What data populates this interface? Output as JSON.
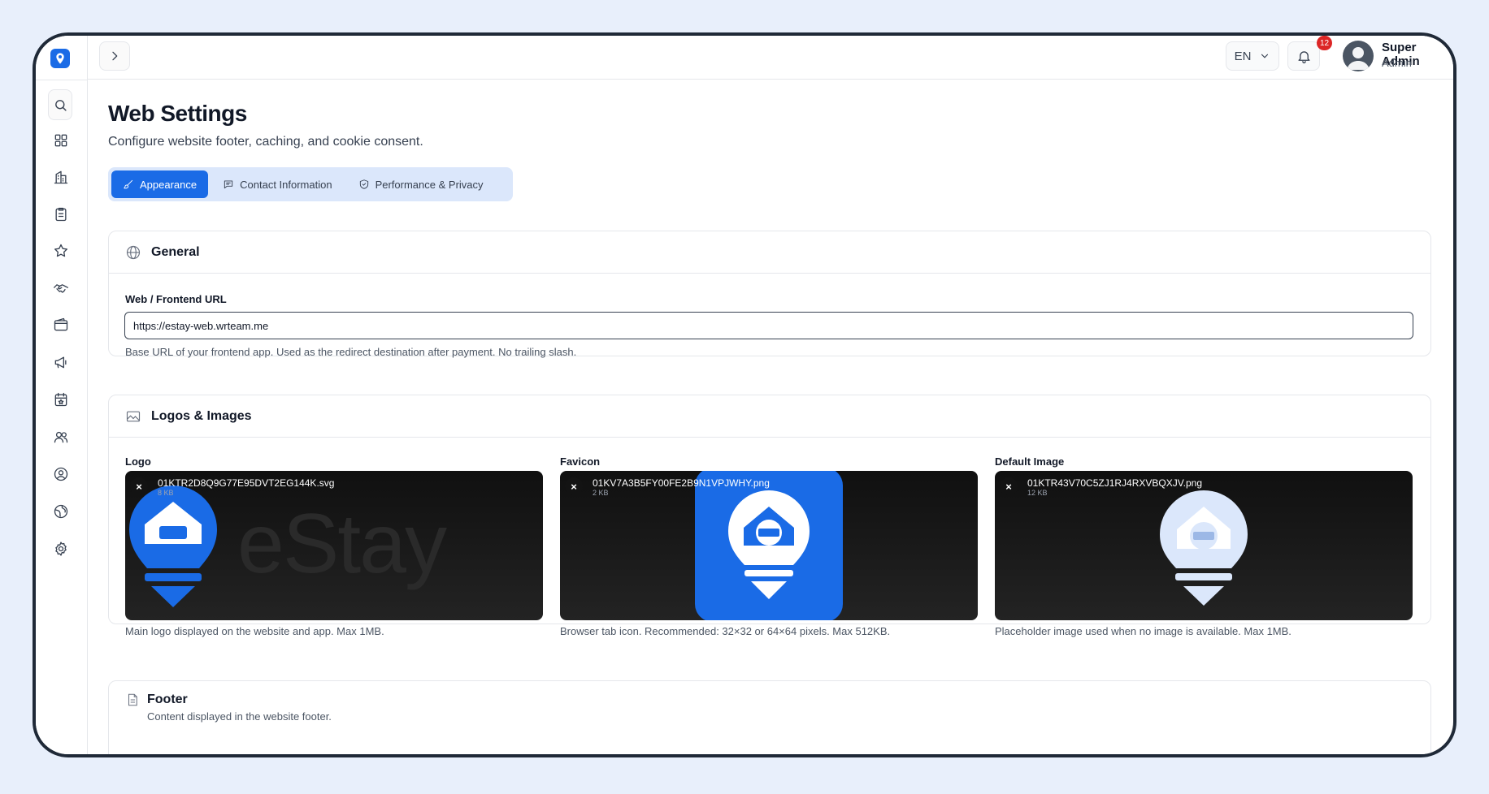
{
  "app": {
    "brand_icon": "map-pin-logo-icon"
  },
  "sidebar": {
    "items": [
      {
        "id": "dashboard",
        "icon": "grid-icon"
      },
      {
        "id": "properties",
        "icon": "building-icon"
      },
      {
        "id": "bookings",
        "icon": "clipboard-icon"
      },
      {
        "id": "reviews",
        "icon": "star-icon"
      },
      {
        "id": "partners",
        "icon": "handshake-icon"
      },
      {
        "id": "wallet",
        "icon": "wallet-icon"
      },
      {
        "id": "marketing",
        "icon": "megaphone-icon"
      },
      {
        "id": "events",
        "icon": "calendar-star-icon"
      },
      {
        "id": "users",
        "icon": "users-icon"
      },
      {
        "id": "account",
        "icon": "user-circle-icon"
      },
      {
        "id": "web",
        "icon": "globe-icon"
      },
      {
        "id": "settings",
        "icon": "gear-icon"
      }
    ]
  },
  "topbar": {
    "language": "EN",
    "notification_count": "12",
    "user": {
      "name": "Super Admin",
      "role": "Admin"
    }
  },
  "page": {
    "title": "Web Settings",
    "subtitle": "Configure website footer, caching, and cookie consent."
  },
  "tabs": [
    {
      "label": "Appearance",
      "active": true
    },
    {
      "label": "Contact Information",
      "active": false
    },
    {
      "label": "Performance & Privacy",
      "active": false
    }
  ],
  "general": {
    "title": "General",
    "url_label": "Web / Frontend URL",
    "url_value": "https://estay-web.wrteam.me",
    "url_help": "Base URL of your frontend app. Used as the redirect destination after payment. No trailing slash."
  },
  "logos": {
    "title": "Logos & Images",
    "items": [
      {
        "label": "Logo",
        "file_name": "01KTR2D8Q9G77E95DVT2EG144K.svg",
        "file_size": "8 KB",
        "help": "Main logo displayed on the website and app. Max 1MB.",
        "preview_text": "eStay"
      },
      {
        "label": "Favicon",
        "file_name": "01KV7A3B5FY00FE2B9N1VPJWHY.png",
        "file_size": "2 KB",
        "help": "Browser tab icon. Recommended: 32×32 or 64×64 pixels. Max 512KB."
      },
      {
        "label": "Default Image",
        "file_name": "01KTR43V70C5ZJ1RJ4RXVBQXJV.png",
        "file_size": "12 KB",
        "help": "Placeholder image used when no image is available. Max 1MB."
      }
    ]
  },
  "footer": {
    "title": "Footer",
    "subtitle": "Content displayed in the website footer."
  },
  "colors": {
    "accent": "#1a6be6",
    "badge": "#dc2626",
    "tab_bg": "#dbe7fb"
  }
}
